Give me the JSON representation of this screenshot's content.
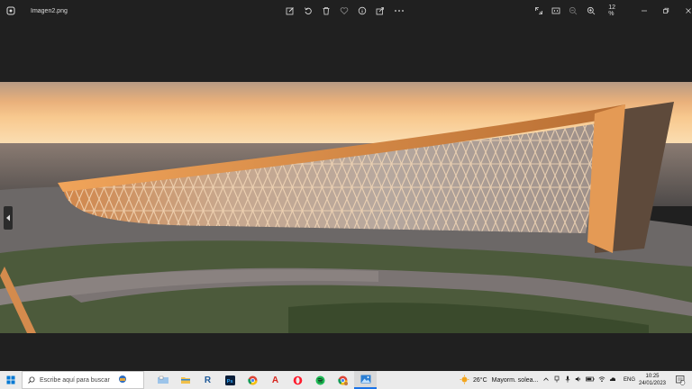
{
  "titlebar": {
    "file_name": "Imagen2.png",
    "zoom_level": "12 %"
  },
  "taskbar": {
    "search_placeholder": "Escribe aquí para buscar",
    "weather_temp": "26°C",
    "weather_desc": "Mayorm. solea...",
    "language": "ENG",
    "time": "10:25",
    "date": "24/01/2023",
    "notification_count": "2"
  },
  "colors": {
    "accent": "#1a73e8",
    "window_bg": "#202020",
    "taskbar_bg": "#ebebeb"
  }
}
